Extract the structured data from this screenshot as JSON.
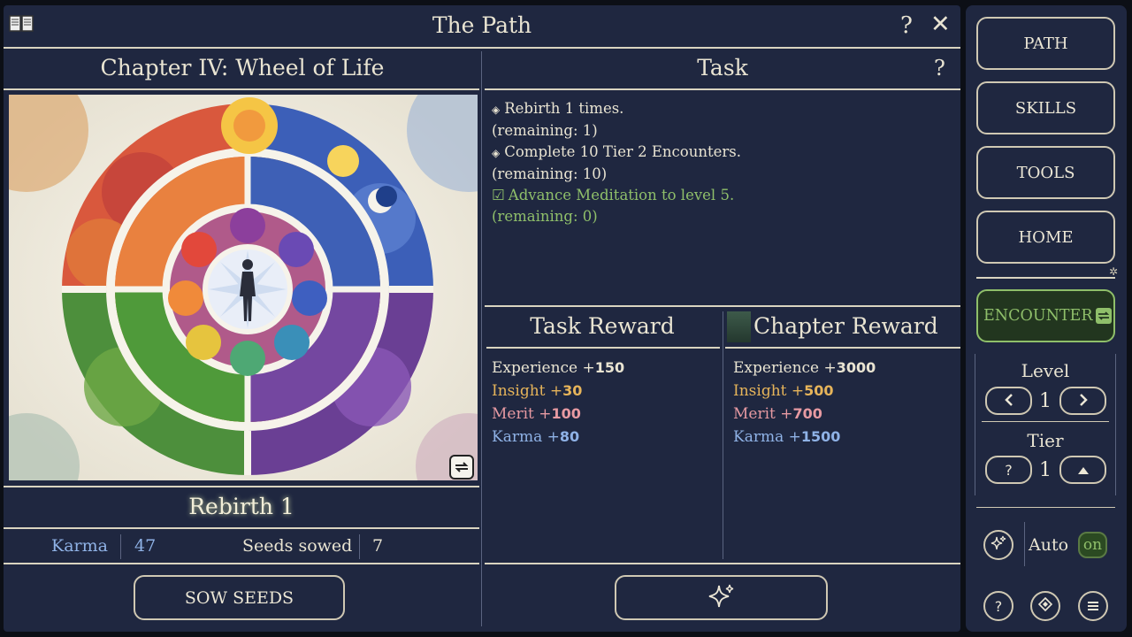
{
  "window": {
    "title": "The Path",
    "help": "?",
    "close": "✕"
  },
  "chapter": {
    "title": "Chapter IV: Wheel of Life"
  },
  "rebirth": {
    "label": "Rebirth 1"
  },
  "stats": {
    "karma_label": "Karma",
    "karma_value": "47",
    "seeds_label": "Seeds sowed",
    "seeds_value": "7"
  },
  "sow_button": "SOW SEEDS",
  "task": {
    "title": "Task",
    "help": "?",
    "items": [
      {
        "marker": "◈",
        "text": "Rebirth 1 times.",
        "remaining": "(remaining: 1)",
        "done": false
      },
      {
        "marker": "◈",
        "text": "Complete 10 Tier 2 Encounters.",
        "remaining": "(remaining: 10)",
        "done": false
      },
      {
        "marker": "☑",
        "text": "Advance Meditation to level 5.",
        "remaining": "(remaining: 0)",
        "done": true
      }
    ]
  },
  "task_reward": {
    "title": "Task Reward",
    "lines": [
      {
        "label": "Experience +",
        "value": "150",
        "color": "#e9e4d2"
      },
      {
        "label": "Insight +",
        "value": "30",
        "color": "#e6b45a"
      },
      {
        "label": "Merit +",
        "value": "100",
        "color": "#e79aa2"
      },
      {
        "label": "Karma +",
        "value": "80",
        "color": "#8fb2e6"
      }
    ]
  },
  "chapter_reward": {
    "title": "Chapter Reward",
    "lines": [
      {
        "label": "Experience +",
        "value": "3000",
        "color": "#e9e4d2"
      },
      {
        "label": "Insight +",
        "value": "500",
        "color": "#e6b45a"
      },
      {
        "label": "Merit +",
        "value": "700",
        "color": "#e79aa2"
      },
      {
        "label": "Karma +",
        "value": "1500",
        "color": "#8fb2e6"
      }
    ]
  },
  "sidebar": {
    "nav": [
      "PATH",
      "SKILLS",
      "TOOLS",
      "HOME"
    ],
    "encounter": "ENCOUNTER",
    "level": {
      "label": "Level",
      "value": "1"
    },
    "tier": {
      "label": "Tier",
      "value": "1",
      "help": "?"
    },
    "auto": {
      "label": "Auto",
      "state": "on"
    },
    "bottom_help": "?"
  },
  "colors": {
    "panel": "#1f2740",
    "accent_green": "#8fbf6a",
    "done_green": "#8fbf6a"
  }
}
